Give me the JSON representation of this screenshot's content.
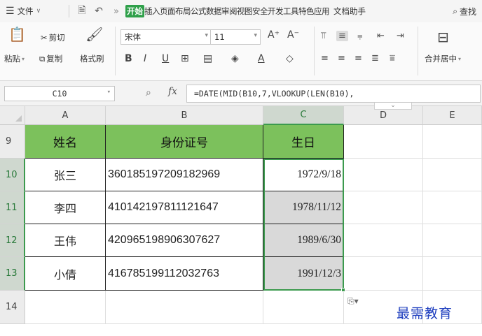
{
  "menubar": {
    "file_label": "文件",
    "tabs_active": "开始",
    "tabs": [
      "插入",
      "页面布局",
      "公式",
      "数据",
      "审阅",
      "视图",
      "安全",
      "开发工具",
      "特色应用"
    ],
    "doc_assistant": "文档助手",
    "search_label": "查找"
  },
  "ribbon": {
    "paste_label": "粘贴",
    "cut_label": "剪切",
    "copy_label": "复制",
    "format_painter_label": "格式刷",
    "font_name": "宋体",
    "font_size": "11",
    "merge_center_label": "合并居中"
  },
  "formula_bar": {
    "name_box": "C10",
    "fx_label": "fx",
    "formula": "=DATE(MID(B10,7,VLOOKUP(LEN(B10),"
  },
  "columns": [
    "A",
    "B",
    "C",
    "D",
    "E"
  ],
  "rows": [
    "9",
    "10",
    "11",
    "12",
    "13",
    "14"
  ],
  "table": {
    "headers": [
      "姓名",
      "身份证号",
      "生日"
    ],
    "rows": [
      {
        "name": "张三",
        "id": "360185197209182969",
        "birthday": "1972/9/18"
      },
      {
        "name": "李四",
        "id": "410142197811121647",
        "birthday": "1978/11/12"
      },
      {
        "name": "王伟",
        "id": "420965198906307627",
        "birthday": "1989/6/30"
      },
      {
        "name": "小倩",
        "id": "416785199112032763",
        "birthday": "1991/12/3"
      }
    ]
  },
  "watermark": "最需教育",
  "colors": {
    "header_fill": "#7cc15c",
    "selection": "#3c9a4e",
    "active_tab": "#2fa04a",
    "watermark": "#1f3fbf"
  }
}
